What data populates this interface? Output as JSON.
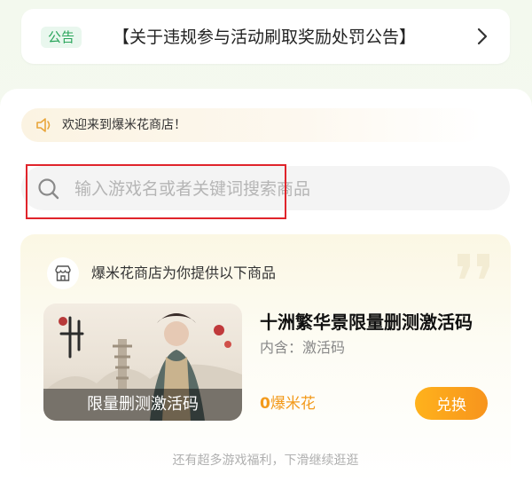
{
  "notice": {
    "tag": "公告",
    "title": "【关于违规参与活动刷取奖励处罚公告】"
  },
  "welcome": {
    "text": "欢迎来到爆米花商店！"
  },
  "search": {
    "placeholder": "输入游戏名或者关键词搜索商品"
  },
  "store_section": {
    "heading": "爆米花商店为你提供以下商品",
    "products": [
      {
        "title": "十洲繁华景限量删测激活码",
        "includes": "内含：激活码",
        "thumbnail_caption": "限量删测激活码",
        "price_amount": "0",
        "price_unit": "爆米花",
        "button_label": "兑换"
      }
    ],
    "more_hint": "还有超多游戏福利，下滑继续逛逛"
  },
  "colors": {
    "accent_orange": "#f7941d",
    "notice_tag_green": "#2aa55b",
    "highlight_red": "#e0242b"
  },
  "icons": {
    "notice_arrow": "chevron-right-icon",
    "welcome": "speaker-icon",
    "search": "search-icon",
    "store": "store-icon",
    "decor": "quote-icon"
  }
}
